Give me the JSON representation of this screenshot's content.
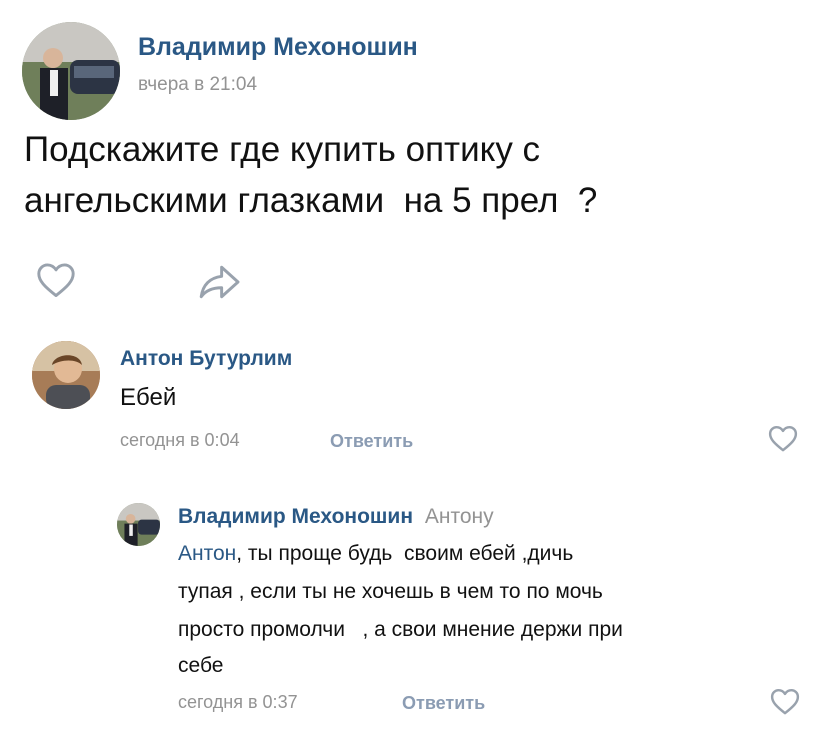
{
  "post": {
    "author": "Владимир Мехоношин",
    "time": "вчера в 21:04",
    "text_line1": "Подскажите где купить оптику с",
    "text_line2": "ангельскими глазками  на 5 прел  ?",
    "like_icon": "heart-outline-icon",
    "share_icon": "share-arrow-icon"
  },
  "comments": [
    {
      "author": "Антон Бутурлим",
      "text": "Ебей",
      "time": "сегодня в 0:04",
      "reply_label": "Ответить",
      "like_icon": "heart-outline-icon"
    },
    {
      "author": "Владимир Мехоношин",
      "reply_to": "Антону",
      "mention": "Антон",
      "text_line1": ", ты проще будь  своим ебей ,дичь",
      "text_line2": "тупая , если ты не хочешь в чем то по мочь",
      "text_line3": "просто промолчи   , а свои мнение держи при",
      "text_line4": "себе",
      "time": "сегодня в 0:37",
      "reply_label": "Ответить",
      "like_icon": "heart-outline-icon"
    }
  ],
  "colors": {
    "name": "#2a5885",
    "meta": "#939393",
    "action": "#8b9cb3",
    "icon": "#99a2ad"
  }
}
